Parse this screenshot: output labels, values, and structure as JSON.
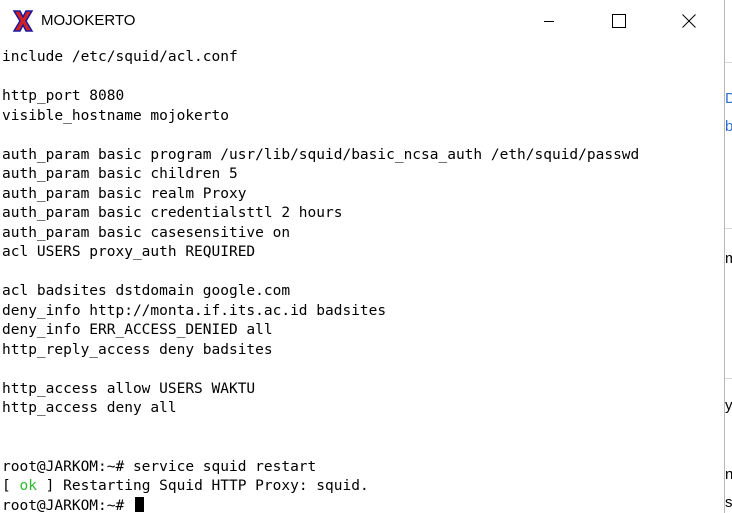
{
  "window": {
    "title": "MOJOKERTO",
    "icon": "putty-x-icon",
    "buttons": {
      "minimize": "minimize-icon",
      "maximize": "maximize-icon",
      "close": "close-icon"
    }
  },
  "terminal": {
    "lines": [
      "include /etc/squid/acl.conf",
      "",
      "http_port 8080",
      "visible_hostname mojokerto",
      "",
      "auth_param basic program /usr/lib/squid/basic_ncsa_auth /eth/squid/passwd",
      "auth_param basic children 5",
      "auth_param basic realm Proxy",
      "auth_param basic credentialsttl 2 hours",
      "auth_param basic casesensitive on",
      "acl USERS proxy_auth REQUIRED",
      "",
      "acl badsites dstdomain google.com",
      "deny_info http://monta.if.its.ac.id badsites",
      "deny_info ERR_ACCESS_DENIED all",
      "http_reply_access deny badsites",
      "",
      "http_access allow USERS WAKTU",
      "http_access deny all",
      "",
      "",
      "root@JARKOM:~# service squid restart"
    ],
    "status_line": {
      "open_bracket": "[ ",
      "ok": "ok",
      "rest": " ] Restarting Squid HTTP Proxy: squid."
    },
    "prompt": "root@JARKOM:~# ",
    "colors": {
      "ok": "#2eb82e",
      "text": "#000000",
      "background": "#ffffff"
    }
  },
  "background_window": {
    "glyphs": [
      "D",
      "b",
      "m",
      "y",
      "n",
      "s"
    ]
  }
}
